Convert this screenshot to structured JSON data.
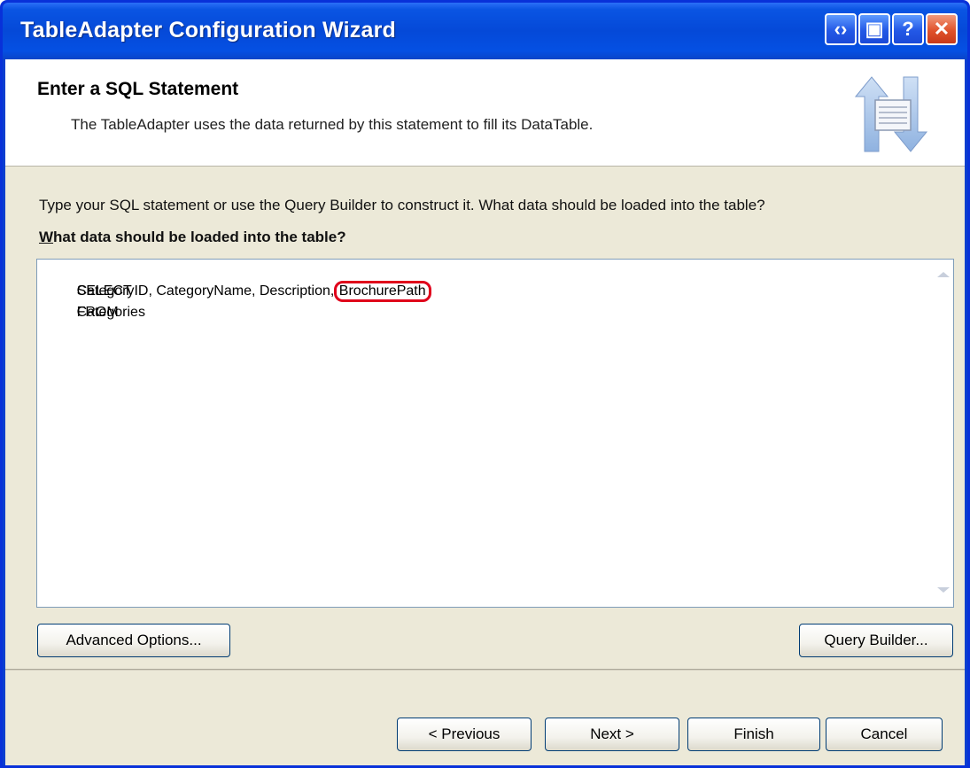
{
  "window": {
    "title": "TableAdapter Configuration Wizard"
  },
  "titlebar_buttons": [
    {
      "name": "navigate-icon",
      "glyph": "‹›"
    },
    {
      "name": "minimize-icon",
      "glyph": "▣"
    },
    {
      "name": "help-icon",
      "glyph": "?"
    },
    {
      "name": "close-icon",
      "glyph": "✕"
    }
  ],
  "header": {
    "title": "Enter a SQL Statement",
    "description": "The TableAdapter uses the data returned by this statement to fill its DataTable."
  },
  "instructions": "Type your SQL statement or use the Query Builder to construct it. What data should be loaded into the table?",
  "prompt": "What data should be loaded into the table?",
  "sql": {
    "select_kw": "SELECT",
    "select_cols": "CategoryID, CategoryName, Description, ",
    "highlighted_col": "BrochurePath",
    "from_kw": "FROM",
    "from_table": "Categories"
  },
  "buttons": {
    "advanced": "Advanced Options...",
    "query_builder": "Query Builder...",
    "previous": "< Previous",
    "next": "Next >",
    "finish": "Finish",
    "cancel": "Cancel"
  },
  "colors": {
    "highlight_ring": "#e0001b",
    "title_blue": "#0549d8"
  }
}
